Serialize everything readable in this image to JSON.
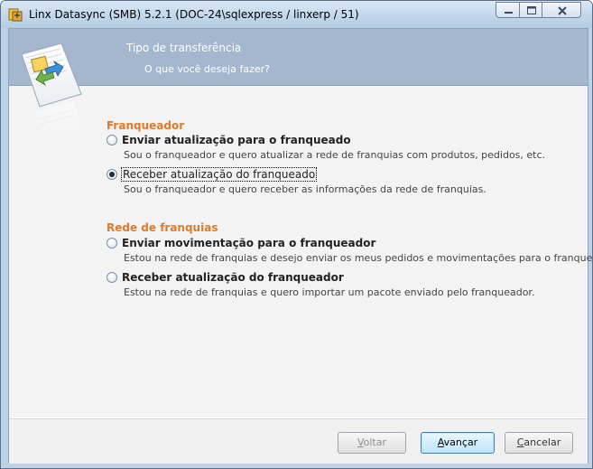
{
  "window": {
    "title": "Linx Datasync (SMB) 5.2.1 (DOC-24\\sqlexpress / linxerp / 51)"
  },
  "banner": {
    "title": "Tipo de transferência",
    "subtitle": "O que você deseja fazer?"
  },
  "sections": [
    {
      "heading": "Franqueador",
      "options": [
        {
          "label": "Enviar atualização para o franqueado",
          "description": "Sou o franqueador e quero atualizar a rede de franquias com produtos, pedidos, etc.",
          "selected": false
        },
        {
          "label": "Receber atualização do franqueado",
          "description": "Sou o franqueador e quero receber as informações da rede de franquias.",
          "selected": true
        }
      ]
    },
    {
      "heading": "Rede de franquias",
      "options": [
        {
          "label": "Enviar movimentação para o franqueador",
          "description": "Estou na rede de franquias e desejo enviar os meus pedidos e movimentações para o franqueador.",
          "selected": false
        },
        {
          "label": "Receber atualização do franqueador",
          "description": "Estou na rede de franquias e quero importar um pacote enviado pelo franqueador.",
          "selected": false
        }
      ]
    }
  ],
  "buttons": {
    "back": {
      "accel": "V",
      "rest": "oltar",
      "enabled": false
    },
    "next": {
      "accel": "A",
      "rest": "vançar",
      "enabled": true
    },
    "cancel": {
      "accel": "C",
      "rest": "ancelar",
      "enabled": true
    }
  },
  "icons": {
    "app": "app-icon",
    "minimize": "minimize-icon",
    "maximize": "maximize-icon",
    "close": "close-icon",
    "wizard": "document-transfer-icon"
  }
}
